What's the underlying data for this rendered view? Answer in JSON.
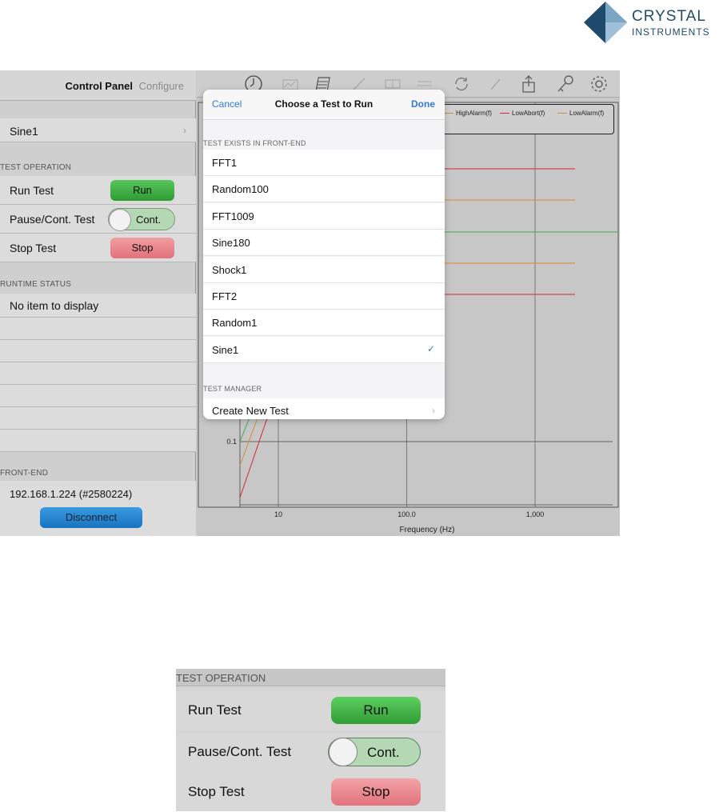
{
  "logo": {
    "line1": "CRYSTAL",
    "line2": "INSTRUMENTS"
  },
  "left_panel": {
    "header": {
      "control_panel": "Control Panel",
      "configure": "Configure"
    },
    "current_test": "Sine1",
    "sections": {
      "test_operation": "TEST OPERATION",
      "runtime_status": "RUNTIME STATUS",
      "front_end": "FRONT-END"
    },
    "operations": {
      "run_label": "Run Test",
      "run_button": "Run",
      "pause_label": "Pause/Cont. Test",
      "pause_toggle": "Cont.",
      "stop_label": "Stop Test",
      "stop_button": "Stop"
    },
    "runtime_empty": "No item to display",
    "front_end_address": "192.168.1.224 (#2580224)",
    "disconnect_button": "Disconnect"
  },
  "toolbar": {
    "icons": [
      "clock-icon",
      "chart-icon",
      "list-icon",
      "pencil-icon",
      "grid-icon",
      "table-icon",
      "refresh-icon",
      "edit-icon",
      "share-icon",
      "key-icon",
      "gear-icon"
    ]
  },
  "legend": {
    "items": [
      {
        "label": "HighAlarm(f)",
        "color": "#d98a2b"
      },
      {
        "label": "LowAbort(f)",
        "color": "#d9252e"
      },
      {
        "label": "LowAlarm(f)",
        "color": "#d98a2b"
      }
    ]
  },
  "chart_data": {
    "type": "line",
    "xlabel": "Frequency (Hz)",
    "x_scale": "log",
    "x_ticks": [
      "10",
      "100.0",
      "1,000"
    ],
    "y_ticks": [
      "0.1"
    ],
    "grid": true
  },
  "popover": {
    "cancel": "Cancel",
    "title": "Choose a Test to Run",
    "done": "Done",
    "section_tests": "TEST EXISTS IN FRONT-END",
    "tests": [
      {
        "name": "FFT1",
        "selected": false
      },
      {
        "name": "Random100",
        "selected": false
      },
      {
        "name": "FFT1009",
        "selected": false
      },
      {
        "name": "Sine180",
        "selected": false
      },
      {
        "name": "Shock1",
        "selected": false
      },
      {
        "name": "FFT2",
        "selected": false
      },
      {
        "name": "Random1",
        "selected": false
      },
      {
        "name": "Sine1",
        "selected": true
      }
    ],
    "checkmark": "✓",
    "section_manager": "TEST MANAGER",
    "create_new": "Create New Test"
  },
  "zoom_panel": {
    "section": "TEST OPERATION",
    "run_label": "Run Test",
    "run_button": "Run",
    "pause_label": "Pause/Cont. Test",
    "pause_toggle": "Cont.",
    "stop_label": "Stop Test",
    "stop_button": "Stop"
  },
  "colors": {
    "run_green": "#3fae44",
    "stop_red": "#e57f87",
    "disconnect_blue": "#2288d4",
    "ios_blue": "#2f7ad8",
    "brand_navy": "#1e4a6c"
  }
}
